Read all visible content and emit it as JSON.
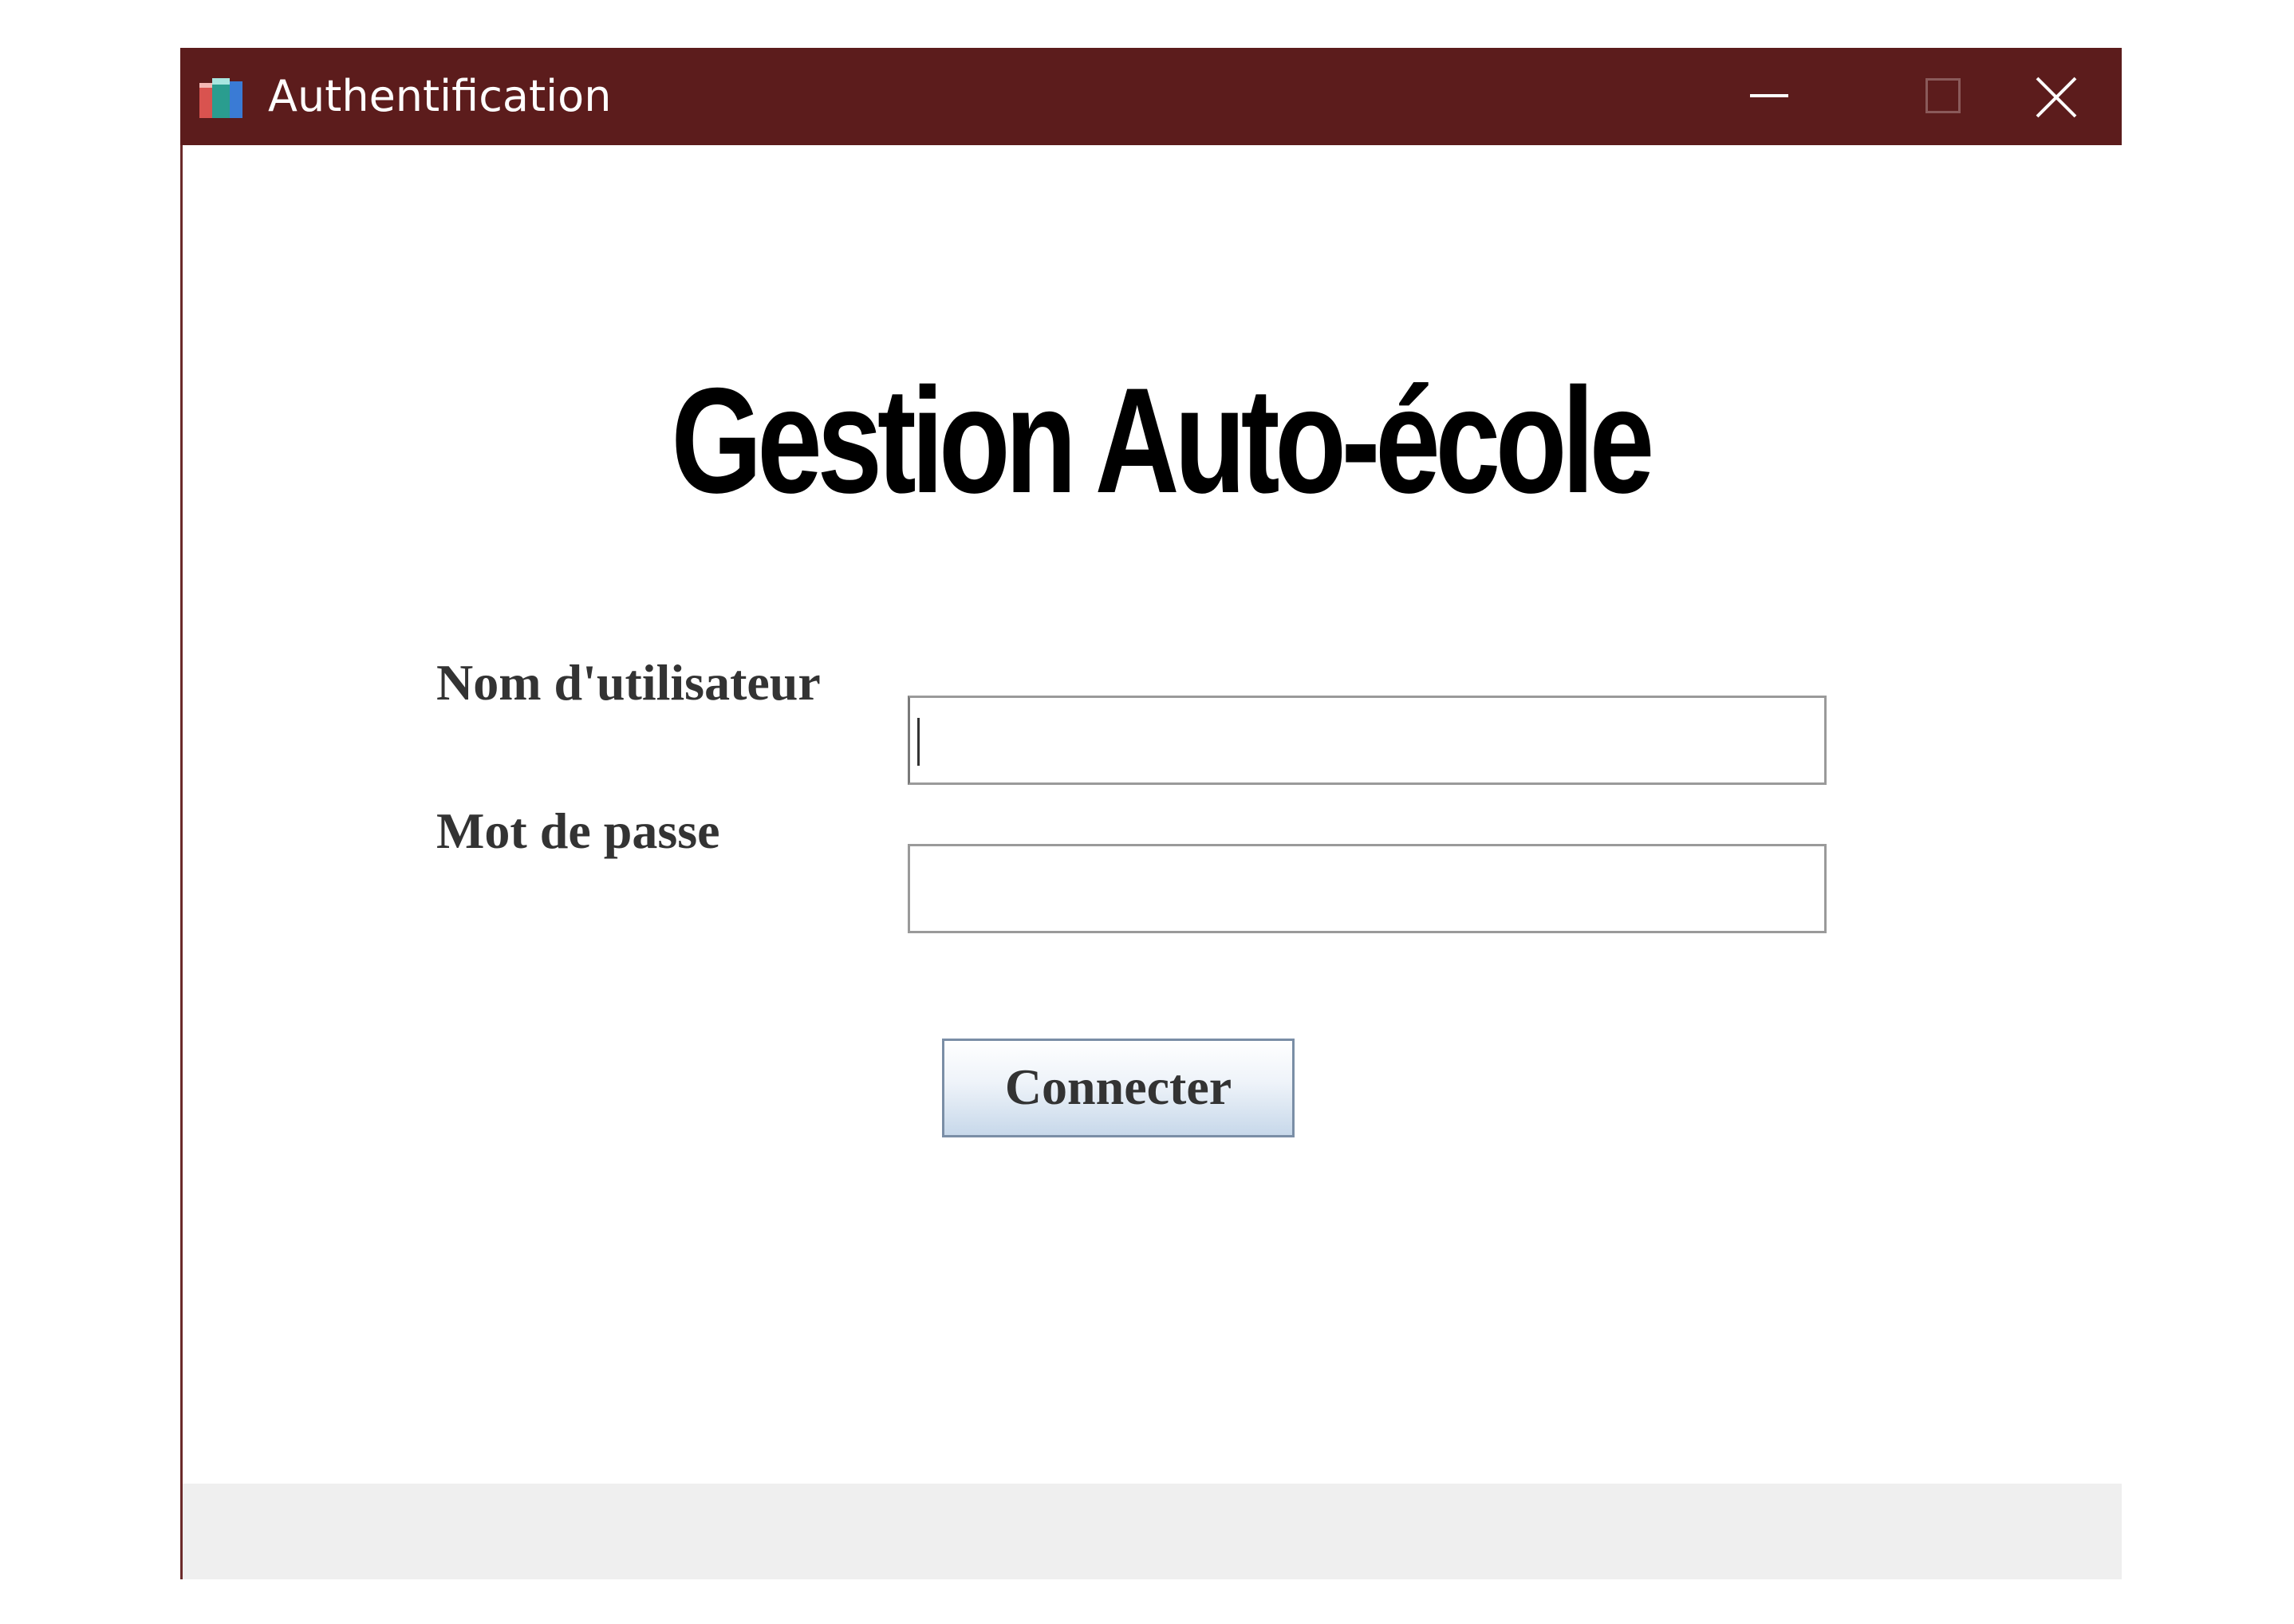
{
  "window": {
    "title": "Authentification",
    "icon": "books-app-icon",
    "controls": {
      "minimize": "minimize-icon",
      "maximize": "maximize-icon",
      "close": "close-icon"
    },
    "titlebar_color": "#5c1c1c"
  },
  "main": {
    "heading": "Gestion Auto-école"
  },
  "form": {
    "username_label": "Nom d'utilisateur",
    "username_value": "",
    "password_label": "Mot de passe",
    "password_value": "",
    "submit_label": "Connecter"
  }
}
